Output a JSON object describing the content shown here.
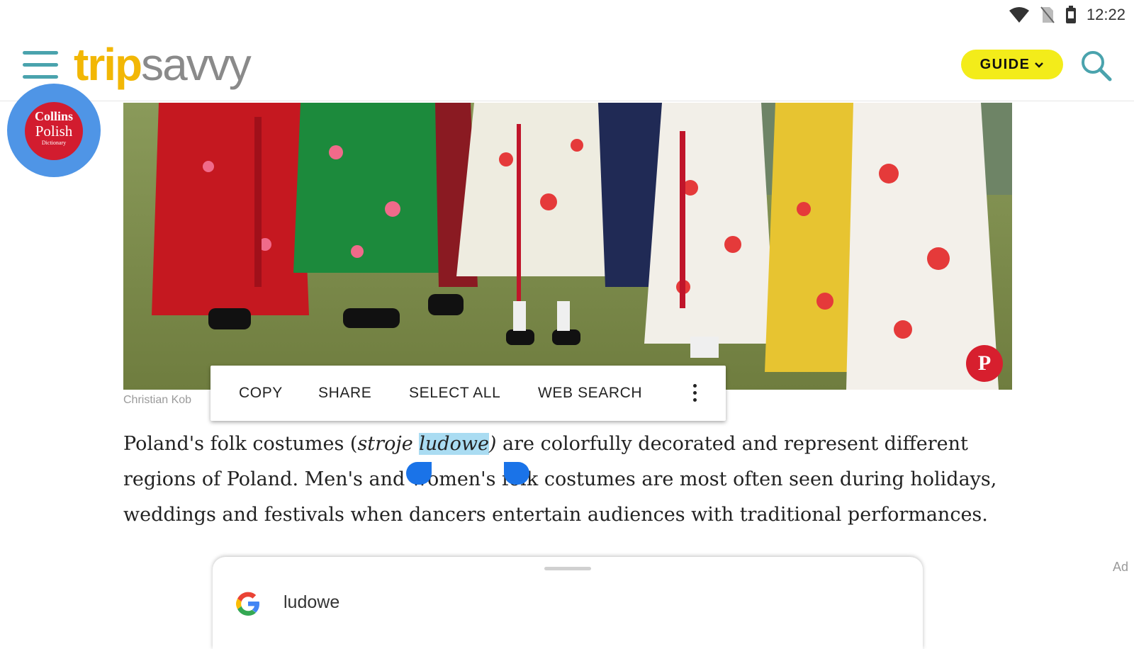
{
  "status_bar": {
    "time": "12:22",
    "icons": [
      "wifi-icon",
      "no-sim-icon",
      "battery-icon"
    ]
  },
  "header": {
    "menu_icon": "hamburger-menu-icon",
    "logo_part1": "trip",
    "logo_part2": "savvy",
    "guide_label": "GUIDE",
    "search_icon": "search-icon",
    "colors": {
      "accent": "#4aa3ad",
      "guide_bg": "#f3ec1a",
      "logo_gold": "#f2b705"
    }
  },
  "floating_bubble": {
    "line1": "Collins",
    "line2": "Polish",
    "line3": "Dictionary"
  },
  "hero": {
    "photo_credit": "Christian Kob",
    "pin_icon": "pinterest-icon"
  },
  "context_menu": {
    "items": [
      {
        "label": "COPY"
      },
      {
        "label": "SHARE"
      },
      {
        "label": "SELECT ALL"
      },
      {
        "label": "WEB SEARCH"
      }
    ],
    "more_icon": "more-vert-icon"
  },
  "article": {
    "p1_before": "Poland's folk costumes (",
    "p1_italic": "stroje ",
    "p1_selected": "ludowe",
    "p1_after_italic": ")",
    "p1_rest": " are colorfully decorated and represent different regions of Poland. Men's and women's folk costumes are most often seen during holidays, weddings and festivals when dancers entertain audiences with traditional performances."
  },
  "ad_label": "Ad",
  "search_sheet": {
    "query": "ludowe",
    "google_icon": "google-icon"
  }
}
